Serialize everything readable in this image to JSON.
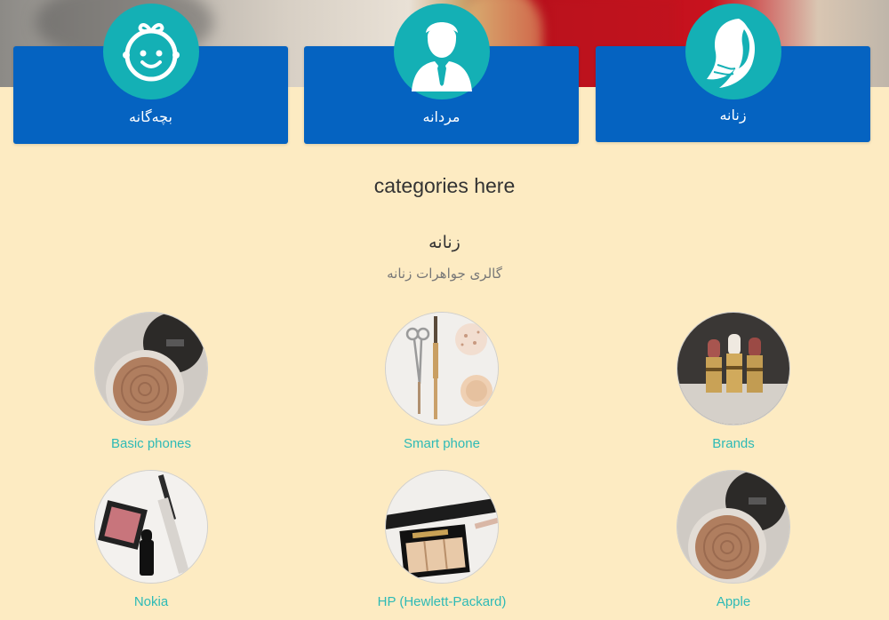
{
  "hero": {
    "banner_text": ""
  },
  "cards": {
    "kids": {
      "label": "بچه‌گانه",
      "icon": "baby-face-icon"
    },
    "men": {
      "label": "مردانه",
      "icon": "businessman-icon"
    },
    "women": {
      "label": "زنانه",
      "icon": "woman-profile-icon"
    }
  },
  "section": {
    "title": "categories here",
    "subtitle": "زنانه",
    "description": "گالری جواهرات زنانه"
  },
  "categories": [
    {
      "name": "Brands",
      "image": "lipsticks"
    },
    {
      "name": "Smart phone",
      "image": "makeup-tools"
    },
    {
      "name": "Basic phones",
      "image": "compact-powder"
    },
    {
      "name": "Apple",
      "image": "compact-powder"
    },
    {
      "name": "HP (Hewlett-Packard)",
      "image": "palette-and-straightener"
    },
    {
      "name": "Nokia",
      "image": "blush-and-lipstick"
    }
  ],
  "colors": {
    "background": "#fdebc2",
    "card": "#0563c1",
    "icon_circle": "#14b0b5",
    "link": "#2dbab6"
  }
}
